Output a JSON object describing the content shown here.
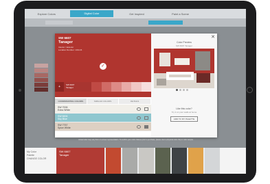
{
  "nav": {
    "tabs": [
      {
        "label": "Explore Colors",
        "active": false
      },
      {
        "label": "Digital Color",
        "active": true
      },
      {
        "label": "Get Inspired",
        "active": false
      },
      {
        "label": "Paint a Scene",
        "active": false
      },
      {
        "label": "",
        "active": false
      }
    ]
  },
  "color": {
    "number": "SW 6607",
    "name": "Tanager",
    "meta_line1": "Interior / Exterior",
    "meta_line2": "Location Number: 130-C6",
    "strip_label_line1": "SW 6607",
    "strip_label_line2": "Tanager",
    "hex": "#b0352f",
    "strip_swatches": [
      "#c04a44",
      "#d06b66",
      "#dd8a86",
      "#e8aaa7",
      "#f0c6c4",
      "#f6dedd"
    ]
  },
  "detail_tabs": [
    {
      "label": "COORDINATING COLORS",
      "active": true
    },
    {
      "label": "SIMILAR COLORS",
      "active": false
    },
    {
      "label": "DETAILS",
      "active": false
    }
  ],
  "coordinating": [
    {
      "number": "SW 7006",
      "name": "Extra White",
      "color": "#f1efe9",
      "text_color": "#444444"
    },
    {
      "number": "SW 6494",
      "name": "Sky Blue",
      "color": "#8fc7cf",
      "text_color": "#ffffff"
    },
    {
      "number": "SW 7757",
      "name": "Spice White",
      "color": "#ddd0c3",
      "text_color": "#444444"
    }
  ],
  "preview": {
    "title": "Color Preview",
    "subtitle": "SW 6607 Tanager",
    "question": "Like this color?",
    "question_sub": "Try it on your walls at home",
    "cta": "ADD TO MY PALETTE"
  },
  "footnote": "Actual color may vary from on-screen representation. To confirm your color choices prior to purchase, please view a physical color chip or color sample.",
  "bottom": {
    "label_line1": "My Color",
    "label_line2": "Palette",
    "label_line3": "CHANGE COLOR",
    "selected_number": "SW 6607",
    "selected_name": "Tanager",
    "swatches": [
      "#c24a30",
      "#a9aaa8",
      "#c9c8c4",
      "#5b624f",
      "#3f4346",
      "#e0a24a",
      "#d4d6d8"
    ]
  },
  "icons": {
    "close": "close-icon",
    "check": "check-icon",
    "add": "add-icon",
    "palette": "palette-icon",
    "store": "store-icon"
  }
}
